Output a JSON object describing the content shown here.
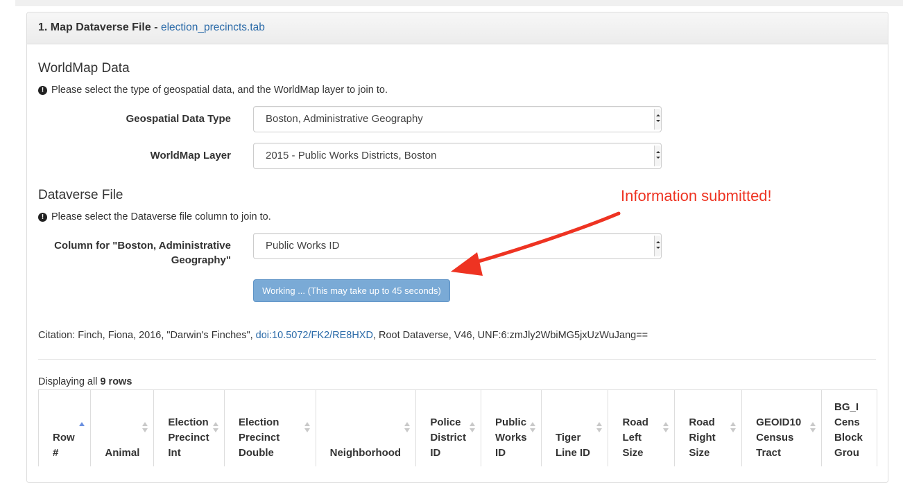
{
  "panel": {
    "title_prefix": "1. Map Dataverse File - ",
    "file_name": "election_precincts.tab"
  },
  "worldmap": {
    "heading": "WorldMap Data",
    "help": "Please select the type of geospatial data, and the WorldMap layer to join to.",
    "geo_type_label": "Geospatial Data Type",
    "geo_type_value": "Boston, Administrative Geography",
    "layer_label": "WorldMap Layer",
    "layer_value": "2015 - Public Works Districts, Boston"
  },
  "dataverse": {
    "heading": "Dataverse File",
    "help": "Please select the Dataverse file column to join to.",
    "column_label_line1": "Column for \"Boston, Administrative",
    "column_label_line2": "Geography\"",
    "column_value": "Public Works ID",
    "working_button": "Working ... (This may take up to 45 seconds)"
  },
  "annotation": {
    "text": "Information submitted!",
    "color": "#ee3322"
  },
  "citation": {
    "prefix": "Citation: Finch, Fiona, 2016, \"Darwin's Finches\", ",
    "doi": "doi:10.5072/FK2/RE8HXD",
    "suffix": ", Root Dataverse, V46, UNF:6:zmJly2WbiMG5jxUzWuJang=="
  },
  "table": {
    "display_prefix": "Displaying all ",
    "display_count": "9 rows",
    "columns": [
      {
        "l1": "",
        "l2": "Row",
        "l3": "#",
        "sort": "asc"
      },
      {
        "l1": "",
        "l2": "",
        "l3": "Animal",
        "sort": "both"
      },
      {
        "l1": "Election",
        "l2": "Precinct",
        "l3": "Int",
        "sort": "both"
      },
      {
        "l1": "Election",
        "l2": "Precinct",
        "l3": "Double",
        "sort": "both"
      },
      {
        "l1": "",
        "l2": "",
        "l3": "Neighborhood",
        "sort": "both"
      },
      {
        "l1": "Police",
        "l2": "District",
        "l3": "ID",
        "sort": "both"
      },
      {
        "l1": "Public",
        "l2": "Works",
        "l3": "ID",
        "sort": "both"
      },
      {
        "l1": "",
        "l2": "Tiger",
        "l3": "Line ID",
        "sort": "both"
      },
      {
        "l1": "Road",
        "l2": "Left",
        "l3": "Size",
        "sort": "both"
      },
      {
        "l1": "Road",
        "l2": "Right",
        "l3": "Size",
        "sort": "both"
      },
      {
        "l1": "GEOID10",
        "l2": "Census",
        "l3": "Tract",
        "sort": "both"
      },
      {
        "l1": "BG_I",
        "l2": "Cens",
        "l3": "Block",
        "l4": "Grou",
        "sort": "none"
      }
    ]
  }
}
